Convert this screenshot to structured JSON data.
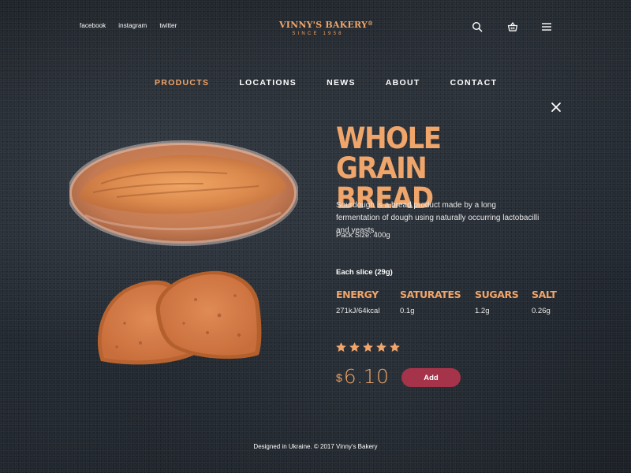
{
  "header": {
    "social": [
      "facebook",
      "instagram",
      "twitter"
    ],
    "logo": {
      "name": "VINNY'S BAKERY",
      "registered": "®",
      "since": "SINCE 1958"
    },
    "icons": [
      "search-icon",
      "basket-icon",
      "menu-icon"
    ]
  },
  "nav": {
    "items": [
      {
        "label": "PRODUCTS",
        "active": true
      },
      {
        "label": "LOCATIONS",
        "active": false
      },
      {
        "label": "NEWS",
        "active": false
      },
      {
        "label": "ABOUT",
        "active": false
      },
      {
        "label": "CONTACT",
        "active": false
      }
    ]
  },
  "product": {
    "title_line1": "WHOLE",
    "title_line2": "GRAIN BREAD",
    "description": "Sourdough is a bread product made by a long fermentation of dough using naturally occurring lactobacilli and yeasts.",
    "pack_size": "Pack Size: 400g",
    "slice_title": "Each slice (29g)",
    "nutrition": [
      {
        "label": "ENERGY",
        "value": "271kJ/64kcal"
      },
      {
        "label": "SATURATES",
        "value": "0.1g"
      },
      {
        "label": "SUGARS",
        "value": "1.2g"
      },
      {
        "label": "SALT",
        "value": "0.26g"
      }
    ],
    "rating": 5,
    "rating_max": 5,
    "price_currency": "$",
    "price_amount": "6.10",
    "add_label": "Add"
  },
  "footer": {
    "text": "Designed in Ukraine. © 2017 Vinny's Bakery"
  },
  "colors": {
    "accent": "#f0a56a",
    "button": "#a5344a",
    "background": "#1e2329"
  }
}
